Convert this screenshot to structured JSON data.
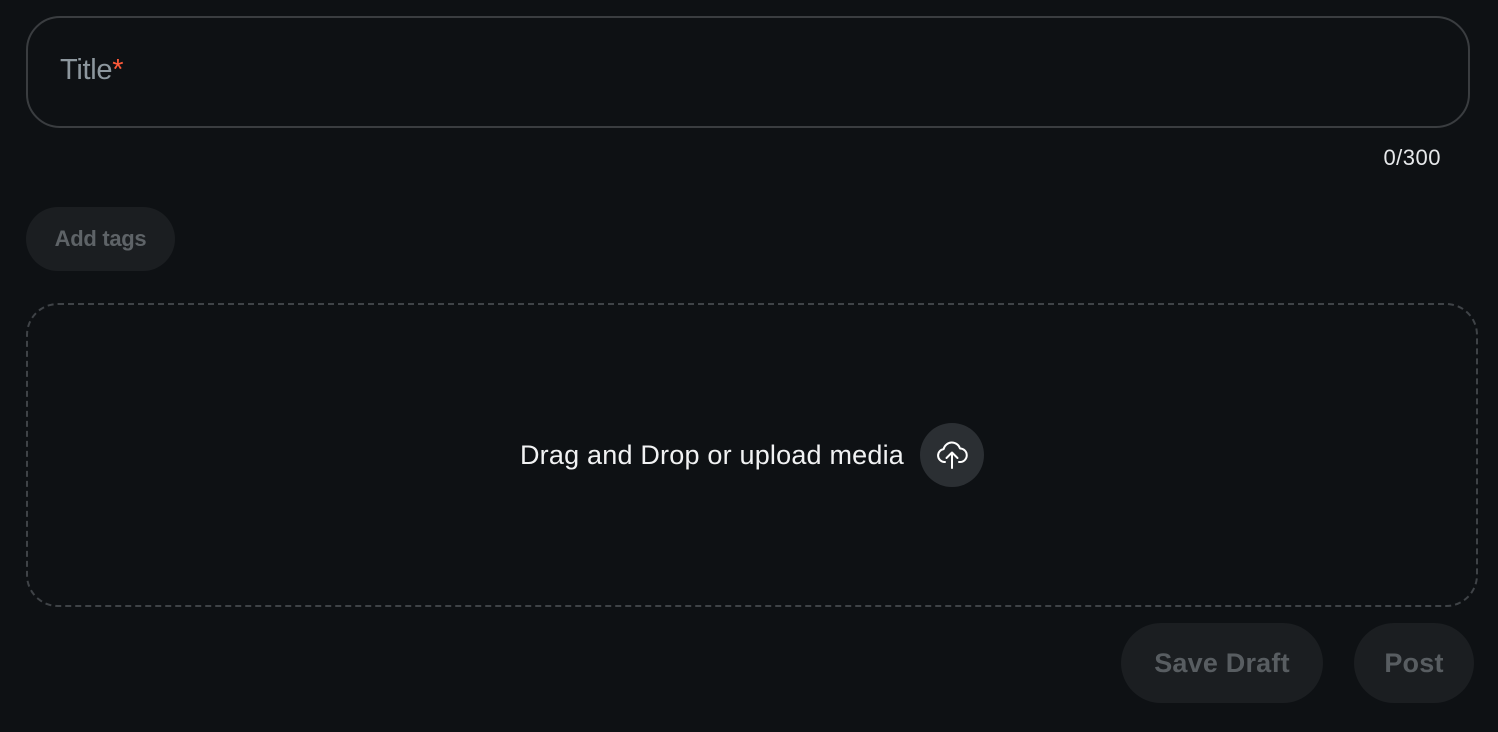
{
  "title_field": {
    "label": "Title",
    "required_marker": "*",
    "value": ""
  },
  "char_count": "0/300",
  "tags": {
    "button_label": "Add tags"
  },
  "dropzone": {
    "text": "Drag and Drop or upload media",
    "icon": "cloud-upload-icon"
  },
  "actions": {
    "save_draft_label": "Save Draft",
    "post_label": "Post"
  },
  "colors": {
    "background": "#0e1114",
    "required": "#ff5a3a",
    "disabled_text": "#585d61",
    "button_bg": "#1b1e21"
  }
}
